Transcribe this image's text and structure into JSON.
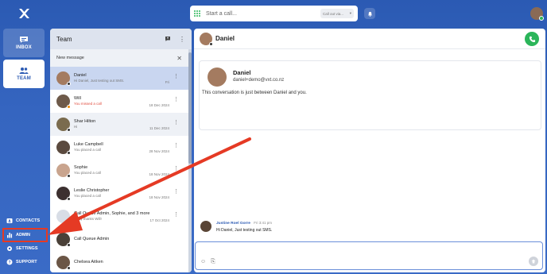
{
  "colors": {
    "brand_blue": "#2b5ab3",
    "accent_green": "#2bb55a",
    "annotation_red": "#e53a24",
    "missed_red": "#e04b3c"
  },
  "sidebar": {
    "inbox_label": "INBOX",
    "team_label": "TEAM",
    "bottom": {
      "contacts": "CONTACTS",
      "admin": "ADMIN",
      "settings": "SETTINGS",
      "support": "SUPPORT"
    }
  },
  "topbar": {
    "call_placeholder": "Start a call...",
    "callout_label": "Call out via...",
    "bell_icon": "bell-icon"
  },
  "team_panel": {
    "title": "Team",
    "new_message": "New message",
    "rows": [
      {
        "name": "Daniel",
        "subtitle": "Hi Daniel, Just testing out SMS.",
        "date": "Fri",
        "status": "offline",
        "selected": true,
        "missed": false
      },
      {
        "name": "Will",
        "subtitle": "You missed a call",
        "date": "18 Dec 2024",
        "status": "away",
        "selected": false,
        "missed": true
      },
      {
        "name": "Shar Hilton",
        "subtitle": "Hi",
        "date": "11 Dec 2024",
        "status": "offline",
        "selected": false,
        "missed": false
      },
      {
        "name": "Luke Campbell",
        "subtitle": "You placed a call",
        "date": "28 Nov 2024",
        "status": "offline",
        "selected": false,
        "missed": false
      },
      {
        "name": "Sophie",
        "subtitle": "You placed a call",
        "date": "18 Nov 2024",
        "status": "offline",
        "selected": false,
        "missed": false
      },
      {
        "name": "Leslie Christopher",
        "subtitle": "You placed a call",
        "date": "18 Nov 2024",
        "status": "offline",
        "selected": false,
        "missed": false
      },
      {
        "name": "Call Queue Admin, Sophie, and 3 more",
        "subtitle": "Okay thanks Will!",
        "date": "17 Oct 2024",
        "status": "offline",
        "selected": false,
        "missed": false
      },
      {
        "name": "Call Queue Admin",
        "subtitle": "",
        "date": "",
        "status": "offline",
        "selected": false,
        "missed": false
      },
      {
        "name": "Chelsea Aitken",
        "subtitle": "",
        "date": "",
        "status": "offline",
        "selected": false,
        "missed": false
      }
    ]
  },
  "conversation": {
    "title": "Daniel",
    "contact": {
      "name": "Daniel",
      "email": "daniel+demo@vxt.co.nz"
    },
    "note": "This conversation is just between Daniel and you.",
    "message": {
      "sender": "Justine Roel Gorre",
      "time": "Fri 3:41 pm",
      "text": "Hi Daniel, Just testing out SMS."
    }
  }
}
